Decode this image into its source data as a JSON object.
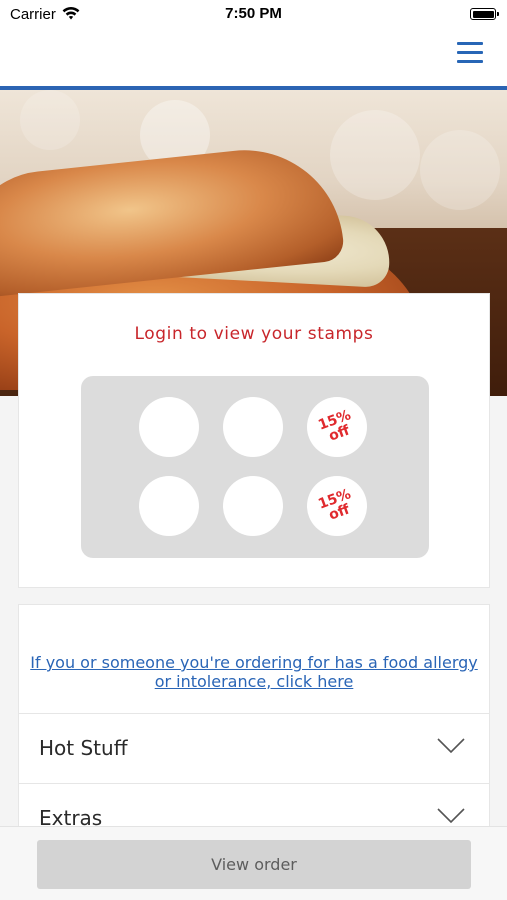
{
  "status_bar": {
    "carrier": "Carrier",
    "time": "7:50 PM"
  },
  "header": {
    "menu_icon": "hamburger-menu-icon",
    "accent_color": "#2c64b3"
  },
  "stamps": {
    "title": "Login to view your stamps",
    "slots": [
      {
        "label": ""
      },
      {
        "label": ""
      },
      {
        "label": "15%\noff"
      },
      {
        "label": ""
      },
      {
        "label": ""
      },
      {
        "label": "15%\noff"
      }
    ]
  },
  "allergy_link": "If you or someone you're ordering for has a food allergy or intolerance, click here",
  "categories": [
    {
      "label": "Hot Stuff",
      "icon": "chevron-down-icon"
    },
    {
      "label": "Extras",
      "icon": "chevron-down-icon"
    }
  ],
  "bottom_bar": {
    "view_order_label": "View order"
  }
}
